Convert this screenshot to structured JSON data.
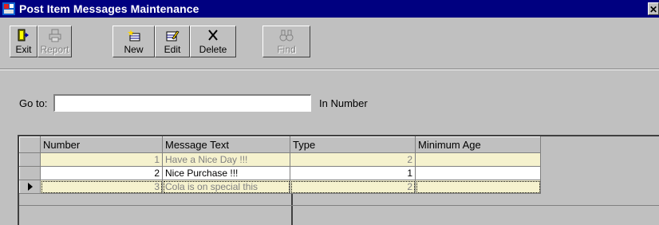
{
  "window": {
    "title": "Post Item Messages Maintenance",
    "close_glyph": "✕"
  },
  "toolbar": {
    "buttons": [
      {
        "label": "Exit",
        "icon": "exit-door-icon",
        "enabled": true
      },
      {
        "label": "Report",
        "icon": "printer-icon",
        "enabled": false
      },
      {
        "label": "New",
        "icon": "new-record-icon",
        "enabled": true
      },
      {
        "label": "Edit",
        "icon": "edit-record-icon",
        "enabled": true
      },
      {
        "label": "Delete",
        "icon": "delete-x-icon",
        "enabled": true
      },
      {
        "label": "Find",
        "icon": "binoculars-icon",
        "enabled": false
      }
    ]
  },
  "goto": {
    "label": "Go to:",
    "value": "",
    "suffix": "In Number"
  },
  "grid": {
    "columns": [
      "Number",
      "Message Text",
      "Type",
      "Minimum Age"
    ],
    "rows": [
      {
        "number": "1",
        "message": "Have a Nice Day !!!",
        "type": "2",
        "min_age": ""
      },
      {
        "number": "2",
        "message": "Nice Purchase !!!",
        "type": "1",
        "min_age": ""
      },
      {
        "number": "3",
        "message": "Cola is on special this",
        "type": "2",
        "min_age": ""
      }
    ]
  },
  "colors": {
    "titlebar": "#000080",
    "face": "#c0c0c0",
    "highlight_row": "#fffbe0"
  }
}
